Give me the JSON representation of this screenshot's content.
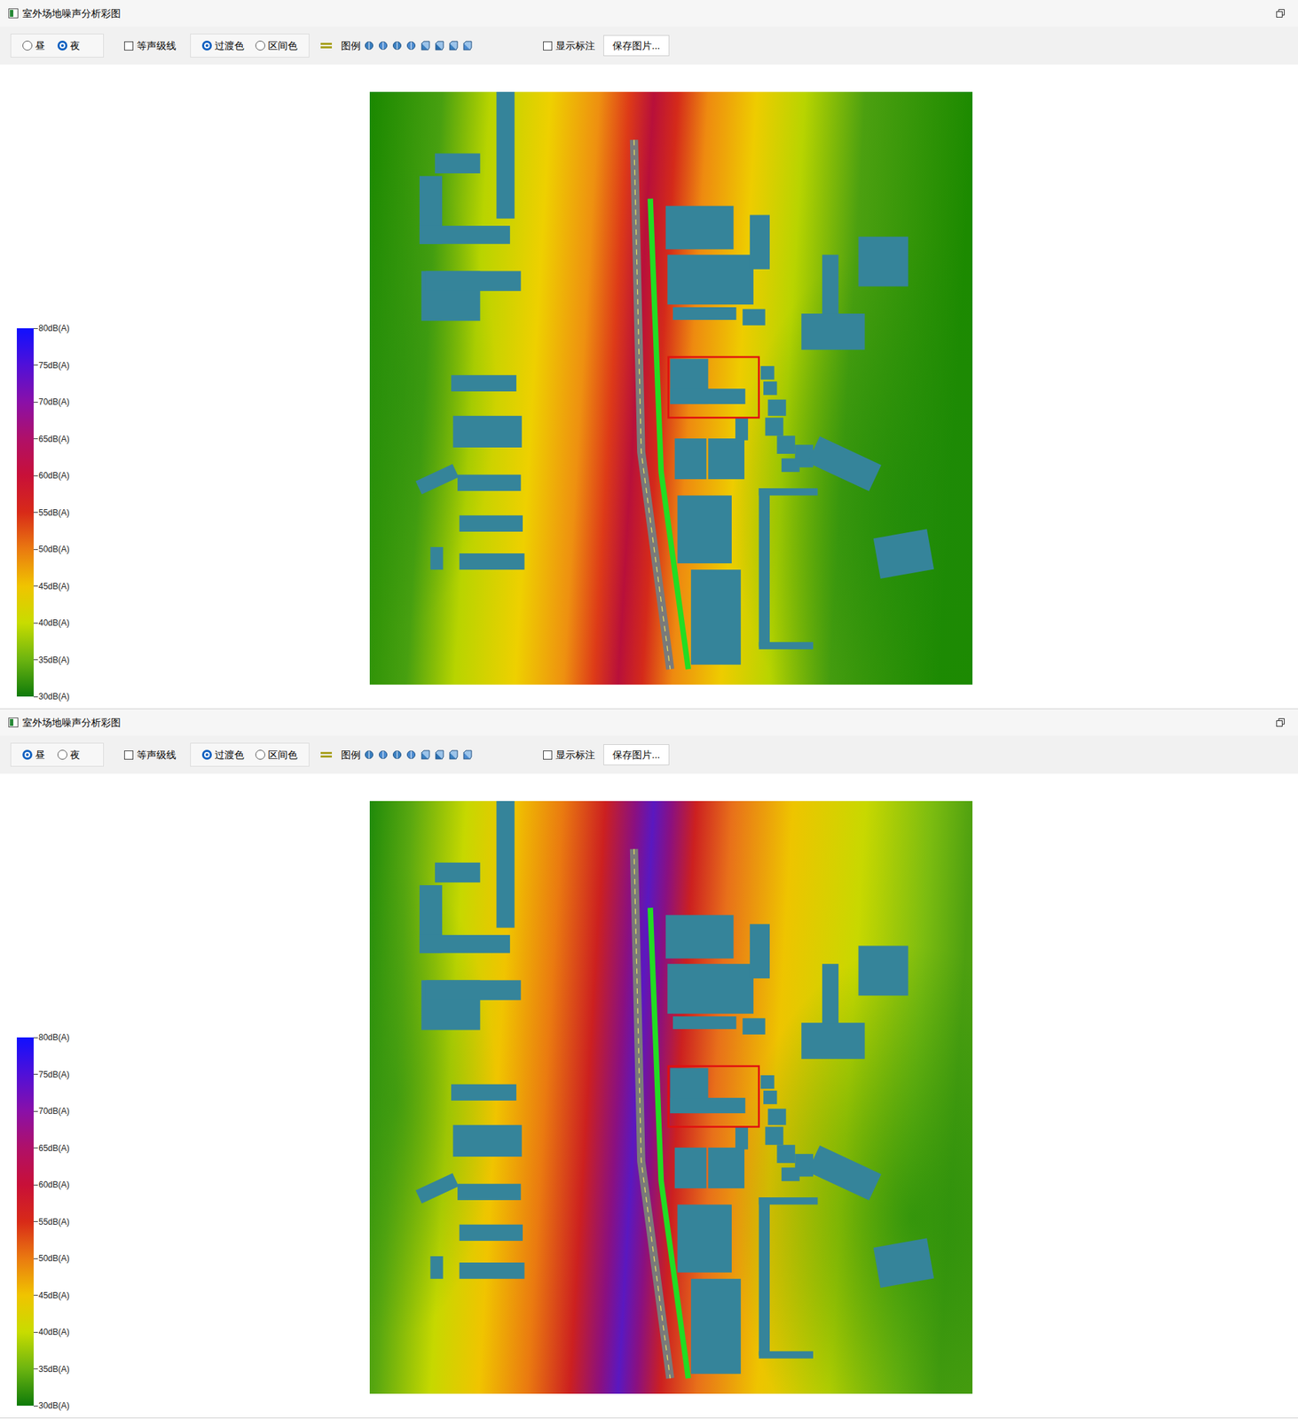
{
  "windows": [
    {
      "title": "室外场地噪声分析彩图",
      "period": [
        {
          "label": "昼",
          "selected": false
        },
        {
          "label": "夜",
          "selected": true
        }
      ],
      "contour": {
        "label": "等声级线",
        "checked": false
      },
      "color_mode": [
        {
          "label": "过渡色",
          "selected": true
        },
        {
          "label": "区间色",
          "selected": false
        }
      ],
      "legend_label": "图例",
      "show_labels": {
        "label": "显示标注",
        "checked": false
      },
      "save_button": "保存图片...",
      "legend_ticks": [
        "80dB(A)",
        "75dB(A)",
        "70dB(A)",
        "65dB(A)",
        "60dB(A)",
        "55dB(A)",
        "50dB(A)",
        "45dB(A)",
        "40dB(A)",
        "35dB(A)",
        "30dB(A)"
      ]
    },
    {
      "title": "室外场地噪声分析彩图",
      "period": [
        {
          "label": "昼",
          "selected": true
        },
        {
          "label": "夜",
          "selected": false
        }
      ],
      "contour": {
        "label": "等声级线",
        "checked": false
      },
      "color_mode": [
        {
          "label": "过渡色",
          "selected": true
        },
        {
          "label": "区间色",
          "selected": false
        }
      ],
      "legend_label": "图例",
      "show_labels": {
        "label": "显示标注",
        "checked": false
      },
      "save_button": "保存图片...",
      "legend_ticks": [
        "80dB(A)",
        "75dB(A)",
        "70dB(A)",
        "65dB(A)",
        "60dB(A)",
        "55dB(A)",
        "50dB(A)",
        "45dB(A)",
        "40dB(A)",
        "35dB(A)",
        "30dB(A)"
      ]
    }
  ]
}
